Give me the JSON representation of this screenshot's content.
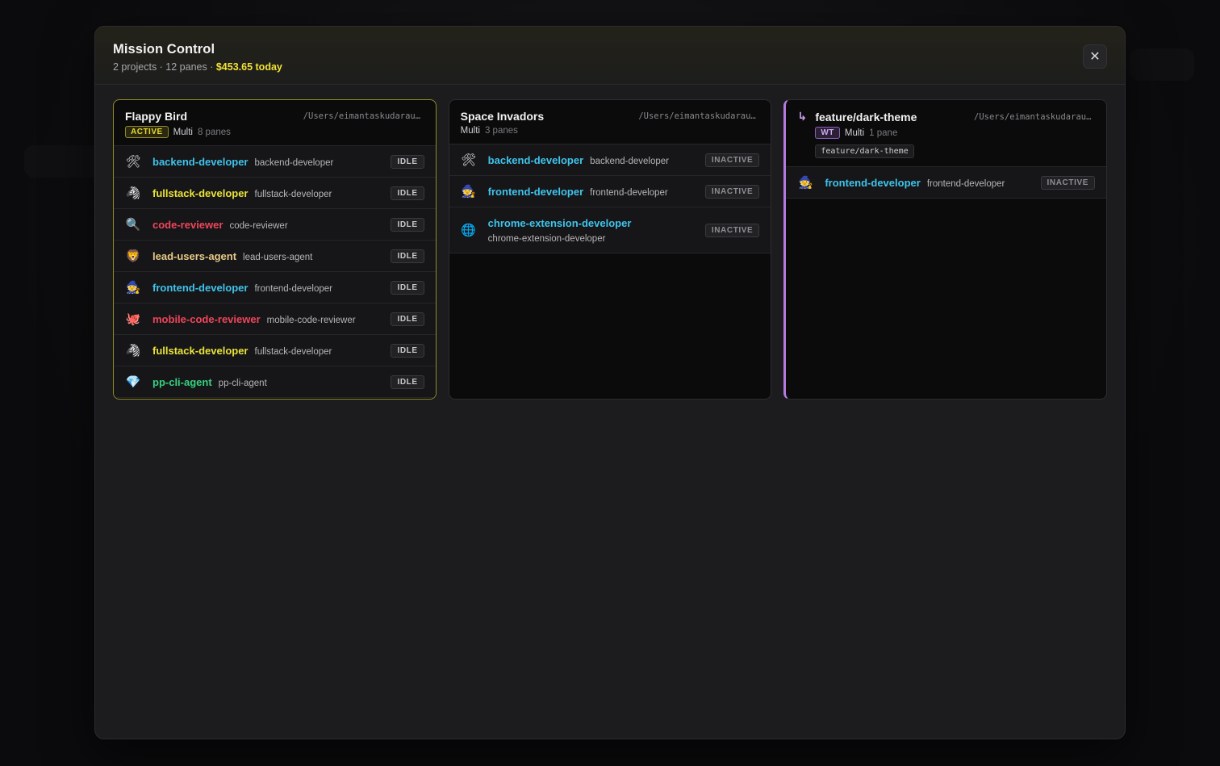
{
  "header": {
    "title": "Mission Control",
    "summary": "2 projects · 12 panes · ",
    "cost": "$453.65 today",
    "close_label": "✕"
  },
  "projects": [
    {
      "name": "Flappy Bird",
      "path": "/Users/eimantaskudarauskas",
      "badge": "ACTIVE",
      "mode": "Multi",
      "panes_label": "8 panes",
      "panes": [
        {
          "icon": "🛠",
          "icon_name": "hammer-wrench-icon",
          "name": "backend-developer",
          "role": "backend-developer",
          "status": "IDLE",
          "color": "#3fc4ec"
        },
        {
          "icon": "🦓",
          "icon_name": "zebra-icon",
          "name": "fullstack-developer",
          "role": "fullstack-developer",
          "status": "IDLE",
          "color": "#e9e23a"
        },
        {
          "icon": "🔍",
          "icon_name": "magnifier-icon",
          "name": "code-reviewer",
          "role": "code-reviewer",
          "status": "IDLE",
          "color": "#f0455c"
        },
        {
          "icon": "🦁",
          "icon_name": "lion-icon",
          "name": "lead-users-agent",
          "role": "lead-users-agent",
          "status": "IDLE",
          "color": "#e8c987"
        },
        {
          "icon": "🧙",
          "icon_name": "wizard-icon",
          "name": "frontend-developer",
          "role": "frontend-developer",
          "status": "IDLE",
          "color": "#3fc4ec"
        },
        {
          "icon": "🐙",
          "icon_name": "octopus-icon",
          "name": "mobile-code-reviewer",
          "role": "mobile-code-reviewer",
          "status": "IDLE",
          "color": "#f0455c"
        },
        {
          "icon": "🦓",
          "icon_name": "zebra-icon",
          "name": "fullstack-developer",
          "role": "fullstack-developer",
          "status": "IDLE",
          "color": "#e9e23a"
        },
        {
          "icon": "💎",
          "icon_name": "gem-icon",
          "name": "pp-cli-agent",
          "role": "pp-cli-agent",
          "status": "IDLE",
          "color": "#37d17e"
        }
      ]
    },
    {
      "name": "Space Invadors",
      "path": "/Users/eimantaskudarauskas",
      "mode": "Multi",
      "panes_label": "3 panes",
      "panes": [
        {
          "icon": "🛠",
          "icon_name": "hammer-wrench-icon",
          "name": "backend-developer",
          "role": "backend-developer",
          "status": "INACTIVE",
          "color": "#3fc4ec"
        },
        {
          "icon": "🧙",
          "icon_name": "wizard-icon",
          "name": "frontend-developer",
          "role": "frontend-developer",
          "status": "INACTIVE",
          "color": "#3fc4ec"
        },
        {
          "icon": "🌐",
          "icon_name": "globe-icon",
          "name": "chrome-extension-developer",
          "role": "chrome-extension-developer",
          "status": "INACTIVE",
          "color": "#3fc4ec"
        }
      ]
    },
    {
      "name": "feature/dark-theme",
      "path": "/Users/eimantaskudarauskas",
      "branch_icon": "↳",
      "badge": "WT",
      "mode": "Multi",
      "panes_label": "1 pane",
      "branch": "feature/dark-theme",
      "panes": [
        {
          "icon": "🧙",
          "icon_name": "wizard-icon",
          "name": "frontend-developer",
          "role": "frontend-developer",
          "status": "INACTIVE",
          "color": "#3fc4ec"
        }
      ]
    }
  ]
}
